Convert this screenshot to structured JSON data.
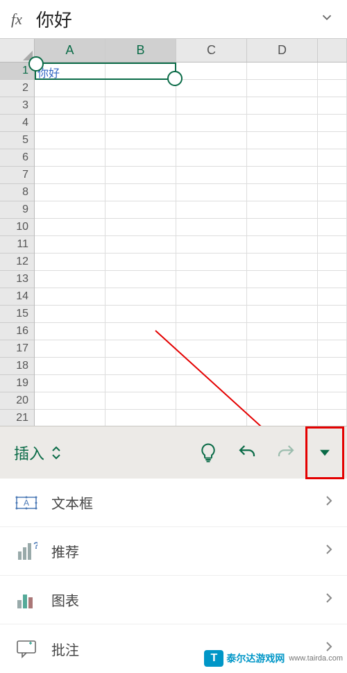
{
  "formula_bar": {
    "fx_label": "fx",
    "value": "你好"
  },
  "columns": [
    "A",
    "B",
    "C",
    "D"
  ],
  "selected_columns": [
    "A",
    "B"
  ],
  "row_count": 21,
  "selected_row": 1,
  "cells": {
    "A1": "你好"
  },
  "toolbar": {
    "label": "插入"
  },
  "menu": [
    {
      "label": "文本框",
      "icon": "textbox-icon"
    },
    {
      "label": "推荐",
      "icon": "recommend-icon"
    },
    {
      "label": "图表",
      "icon": "chart-icon"
    },
    {
      "label": "批注",
      "icon": "comment-icon"
    }
  ],
  "watermark": {
    "badge": "T",
    "text": "泰尔达游戏网",
    "url": "www.tairda.com"
  }
}
